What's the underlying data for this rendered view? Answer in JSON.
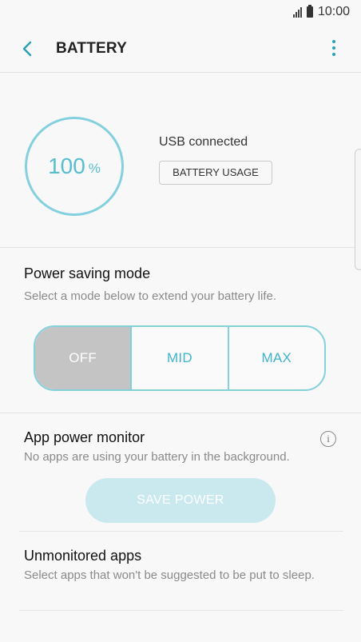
{
  "status_bar": {
    "time": "10:00"
  },
  "header": {
    "title": "BATTERY"
  },
  "battery": {
    "level": "100",
    "unit": "%",
    "connection_status": "USB connected",
    "usage_button_label": "BATTERY USAGE"
  },
  "power_saving": {
    "title": "Power saving mode",
    "subtitle": "Select a mode below to extend your battery life.",
    "modes": [
      "OFF",
      "MID",
      "MAX"
    ],
    "selected": "OFF"
  },
  "app_power_monitor": {
    "title": "App power monitor",
    "subtitle": "No apps are using your battery in the background.",
    "button_label": "SAVE POWER"
  },
  "unmonitored_apps": {
    "title": "Unmonitored apps",
    "subtitle": "Select apps that won't be suggested to be put to sleep."
  },
  "colors": {
    "accent": "#84d0de",
    "accent_text": "#3db4cc",
    "selected_segment": "#c4c4c4",
    "disabled_button": "#c9e9ef"
  }
}
